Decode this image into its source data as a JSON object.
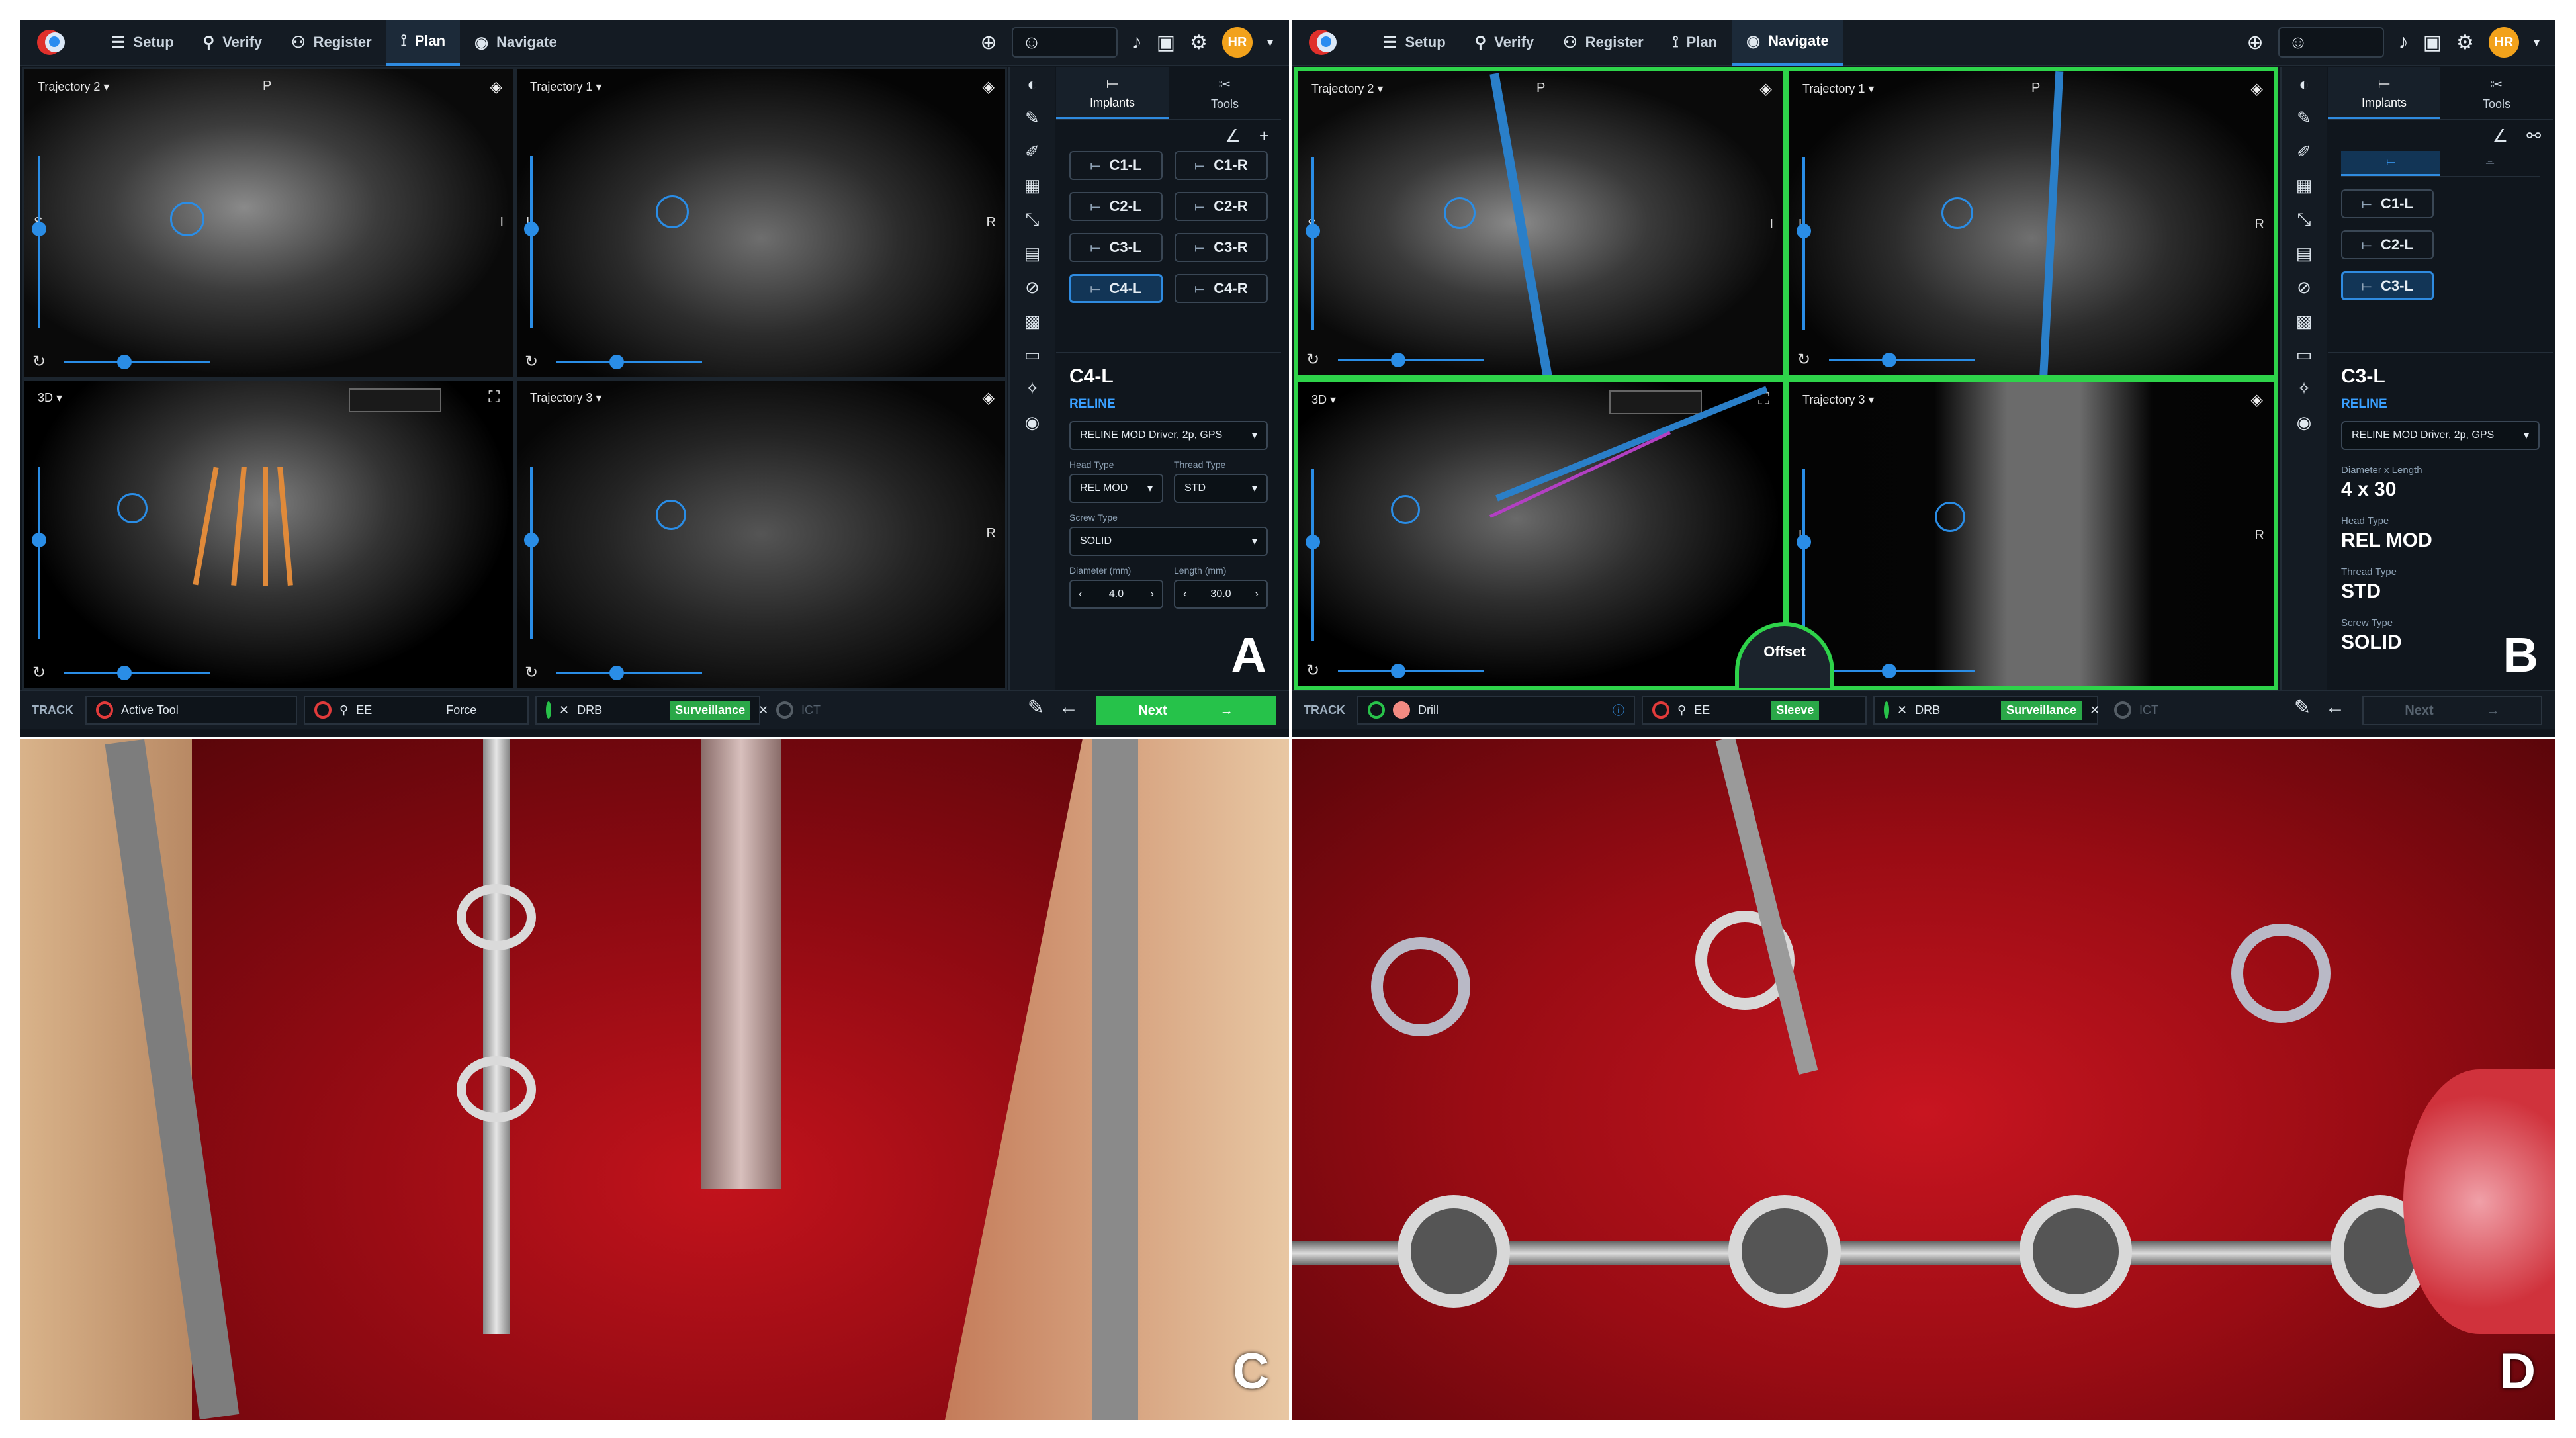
{
  "nav": {
    "items": [
      {
        "label": "Setup",
        "icon": "list-icon"
      },
      {
        "label": "Verify",
        "icon": "wand-icon"
      },
      {
        "label": "Register",
        "icon": "person-icon"
      },
      {
        "label": "Plan",
        "icon": "plan-icon"
      },
      {
        "label": "Navigate",
        "icon": "navigate-icon"
      }
    ],
    "user_initials": "HR"
  },
  "panelA": {
    "active_nav": "Plan",
    "viewports": [
      {
        "label": "Trajectory 2"
      },
      {
        "label": "Trajectory 1"
      },
      {
        "label": "3D"
      },
      {
        "label": "Trajectory 3"
      }
    ],
    "tabs": {
      "implants": "Implants",
      "tools": "Tools"
    },
    "implants": [
      "C1-L",
      "C1-R",
      "C2-L",
      "C2-R",
      "C3-L",
      "C3-R",
      "C4-L",
      "C4-R"
    ],
    "selected_implant": "C4-L",
    "detail": {
      "title": "C4-L",
      "brand": "RELINE",
      "driver": "RELINE MOD Driver, 2p, GPS",
      "head_type_label": "Head Type",
      "head_type": "REL MOD",
      "thread_type_label": "Thread Type",
      "thread_type": "STD",
      "screw_type_label": "Screw Type",
      "screw_type": "SOLID",
      "diameter_label": "Diameter (mm)",
      "diameter": "4.0",
      "length_label": "Length (mm)",
      "length": "30.0"
    },
    "letter": "A",
    "track": {
      "label": "TRACK",
      "active_tool": "Active Tool",
      "ee": "EE",
      "force": "Force",
      "drb": "DRB",
      "surveillance": "Surveillance",
      "ict": "ICT"
    },
    "next": "Next"
  },
  "panelB": {
    "active_nav": "Navigate",
    "viewports": [
      {
        "label": "Trajectory 2"
      },
      {
        "label": "Trajectory 1"
      },
      {
        "label": "3D"
      },
      {
        "label": "Trajectory 3"
      }
    ],
    "tabs": {
      "implants": "Implants",
      "tools": "Tools"
    },
    "implants": [
      "C1-L",
      "C2-L",
      "C3-L"
    ],
    "selected_implant": "C3-L",
    "detail": {
      "title": "C3-L",
      "brand": "RELINE",
      "driver": "RELINE MOD Driver, 2p, GPS",
      "dim_label": "Diameter x Length",
      "dim": "4 x 30",
      "head_type_label": "Head Type",
      "head_type": "REL MOD",
      "thread_type_label": "Thread Type",
      "thread_type": "STD",
      "screw_type_label": "Screw Type",
      "screw_type": "SOLID"
    },
    "offset": "Offset",
    "letter": "B",
    "track": {
      "label": "TRACK",
      "drill": "Drill",
      "ee": "EE",
      "sleeve": "Sleeve",
      "drb": "DRB",
      "surveillance": "Surveillance",
      "ict": "ICT"
    },
    "next": "Next"
  },
  "photoC": {
    "letter": "C"
  },
  "photoD": {
    "letter": "D"
  }
}
